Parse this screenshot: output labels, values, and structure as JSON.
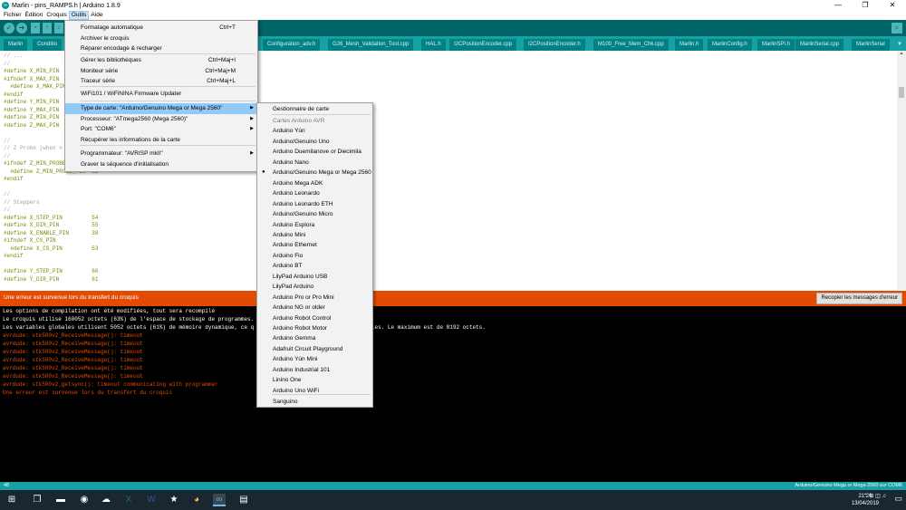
{
  "window": {
    "title": "Marlin - pins_RAMPS.h | Arduino 1.8.9",
    "app_icon": "arduino-icon",
    "controls": [
      "—",
      "❐",
      "✕"
    ]
  },
  "menubar": [
    "Fichier",
    "Édition",
    "Croquis",
    "Outils",
    "Aide"
  ],
  "tabs": [
    "Marlin",
    "Conditio",
    "Configuration_adv.h",
    "G26_Mesh_Validation_Tool.cpp",
    "HAL.h",
    "I2CPositionEncoder.cpp",
    "I2CPositionEncoder.h",
    "M100_Free_Mem_Chk.cpp",
    "Marlin.h",
    "MarlinConfig.h",
    "MarlinSPI.h",
    "MarlinSerial.cpp",
    "MarlinSerial"
  ],
  "tab_menu_glyph": "▼",
  "code_lines": [
    {
      "t": "// ...",
      "k": "cm"
    },
    {
      "t": "//",
      "k": "cm"
    },
    {
      "t": "#define X_MIN_PIN",
      "k": "pp"
    },
    {
      "t": "#ifndef X_MAX_PIN",
      "k": "pp"
    },
    {
      "t": "  #define X_MAX_PIN",
      "k": "pp"
    },
    {
      "t": "#endif",
      "k": "pp"
    },
    {
      "t": "#define Y_MIN_PIN",
      "k": "pp"
    },
    {
      "t": "#define Y_MAX_PIN",
      "k": "pp"
    },
    {
      "t": "#define Z_MIN_PIN",
      "k": "pp"
    },
    {
      "t": "#define Z_MAX_PIN",
      "k": "pp"
    },
    {
      "t": "",
      "k": ""
    },
    {
      "t": "//",
      "k": "cm"
    },
    {
      "t": "// Z Probe (when n",
      "k": "cm"
    },
    {
      "t": "//",
      "k": "cm"
    },
    {
      "t": "#ifndef Z_MIN_PROBE",
      "k": "pp"
    },
    {
      "t": "  #define Z_MIN_PROBE_PIN  32",
      "k": "pp"
    },
    {
      "t": "#endif",
      "k": "pp"
    },
    {
      "t": "",
      "k": ""
    },
    {
      "t": "//",
      "k": "cm"
    },
    {
      "t": "// Steppers",
      "k": "cm"
    },
    {
      "t": "//",
      "k": "cm"
    },
    {
      "t": "#define X_STEP_PIN         54",
      "k": "pp"
    },
    {
      "t": "#define X_DIR_PIN          55",
      "k": "pp"
    },
    {
      "t": "#define X_ENABLE_PIN       38",
      "k": "pp"
    },
    {
      "t": "#ifndef X_CS_PIN",
      "k": "pp"
    },
    {
      "t": "  #define X_CS_PIN         53",
      "k": "pp"
    },
    {
      "t": "#endif",
      "k": "pp"
    },
    {
      "t": "",
      "k": ""
    },
    {
      "t": "#define Y_STEP_PIN         60",
      "k": "pp"
    },
    {
      "t": "#define Y_DIR_PIN          61",
      "k": "pp"
    }
  ],
  "error_bar": {
    "message": "Une erreur est survenue lors du transfert du croquis",
    "copy_button": "Recopier les messages d'erreur"
  },
  "console_lines": [
    {
      "t": "Les options de compilation ont été modifiées, tout sera recompilé",
      "c": "#ffffff"
    },
    {
      "t": "Le croquis utilise 160052 octets (63%) de l'espace de stockage de programmes.",
      "c": "#ffffff"
    },
    {
      "t": "Les variables globales utilisent 5052 octets (61%) de mémoire dynamique, ce q                          ables locales. Le maximum est de 8192 octets.",
      "c": "#ffffff"
    },
    {
      "t": "avrdude: stk500v2_ReceiveMessage(): timeout",
      "c": "#e34c00"
    },
    {
      "t": "avrdude: stk500v2_ReceiveMessage(): timeout",
      "c": "#e34c00"
    },
    {
      "t": "avrdude: stk500v2_ReceiveMessage(): timeout",
      "c": "#e34c00"
    },
    {
      "t": "avrdude: stk500v2_ReceiveMessage(): timeout",
      "c": "#e34c00"
    },
    {
      "t": "avrdude: stk500v2_ReceiveMessage(): timeout",
      "c": "#e34c00"
    },
    {
      "t": "avrdude: stk500v2_ReceiveMessage(): timeout",
      "c": "#e34c00"
    },
    {
      "t": "avrdude: stk500v2_getsync(): timeout communicating with programmer",
      "c": "#e34c00"
    },
    {
      "t": "Une erreur est survenue lors du transfert du croquis",
      "c": "#e34c00"
    }
  ],
  "statusbar": {
    "line": "48",
    "board": "Arduino/Genuino Mega or Mega 2560 sur COM6"
  },
  "tools_menu": [
    {
      "label": "Formatage automatique",
      "shortcut": "Ctrl+T"
    },
    {
      "label": "Archiver le croquis",
      "shortcut": ""
    },
    {
      "label": "Réparer encodage & recharger",
      "shortcut": ""
    },
    {
      "label": "Gérer les bibliothèques",
      "shortcut": "Ctrl+Maj+I"
    },
    {
      "label": "Moniteur série",
      "shortcut": "Ctrl+Maj+M"
    },
    {
      "label": "Traceur série",
      "shortcut": "Ctrl+Maj+L"
    },
    {
      "label": "WiFi101 / WiFiNINA Firmware Updater",
      "shortcut": ""
    },
    {
      "label": "Type de carte: \"Arduino/Genuino Mega or Mega 2560\"",
      "shortcut": "",
      "arrow": "▶"
    },
    {
      "label": "Processeur: \"ATmega2560 (Mega 2560)\"",
      "shortcut": "",
      "arrow": "▶"
    },
    {
      "label": "Port: \"COM6\"",
      "shortcut": "",
      "arrow": "▶"
    },
    {
      "label": "Récupérer les informations de la carte",
      "shortcut": ""
    },
    {
      "label": "Programmateur: \"AVRISP mkII\"",
      "shortcut": "",
      "arrow": "▶"
    },
    {
      "label": "Graver la séquence d'initialisation",
      "shortcut": ""
    }
  ],
  "board_menu": [
    "Gestionnaire de carte",
    "Cartes Arduino AVR",
    "Arduino Yún",
    "Arduino/Genuino Uno",
    "Arduino Duemilanove or Diecimila",
    "Arduino Nano",
    "Arduino/Genuino Mega or Mega 2560",
    "Arduino Mega ADK",
    "Arduino Leonardo",
    "Arduino Leonardo ETH",
    "Arduino/Genuino Micro",
    "Arduino Esplora",
    "Arduino Mini",
    "Arduino Ethernet",
    "Arduino Fio",
    "Arduino BT",
    "LilyPad Arduino USB",
    "LilyPad Arduino",
    "Arduino Pro or Pro Mini",
    "Arduino NG or older",
    "Arduino Robot Control",
    "Arduino Robot Motor",
    "Arduino Gemma",
    "Adafruit Circuit Playground",
    "Arduino Yún Mini",
    "Arduino Industrial 101",
    "Linino One",
    "Arduino Uno WiFi",
    "Sanguino"
  ],
  "board_selected_marker": "●",
  "taskbar": {
    "clock_time": "21:26",
    "clock_date": "13/04/2019",
    "icons": [
      "windows-start-icon",
      "task-view-icon",
      "explorer-icon",
      "chrome-icon",
      "arduino-icon"
    ]
  },
  "colors": {
    "accent": "#00979c",
    "toolbar": "#006468",
    "error": "#e34c00",
    "highlight": "#91c9f7"
  }
}
